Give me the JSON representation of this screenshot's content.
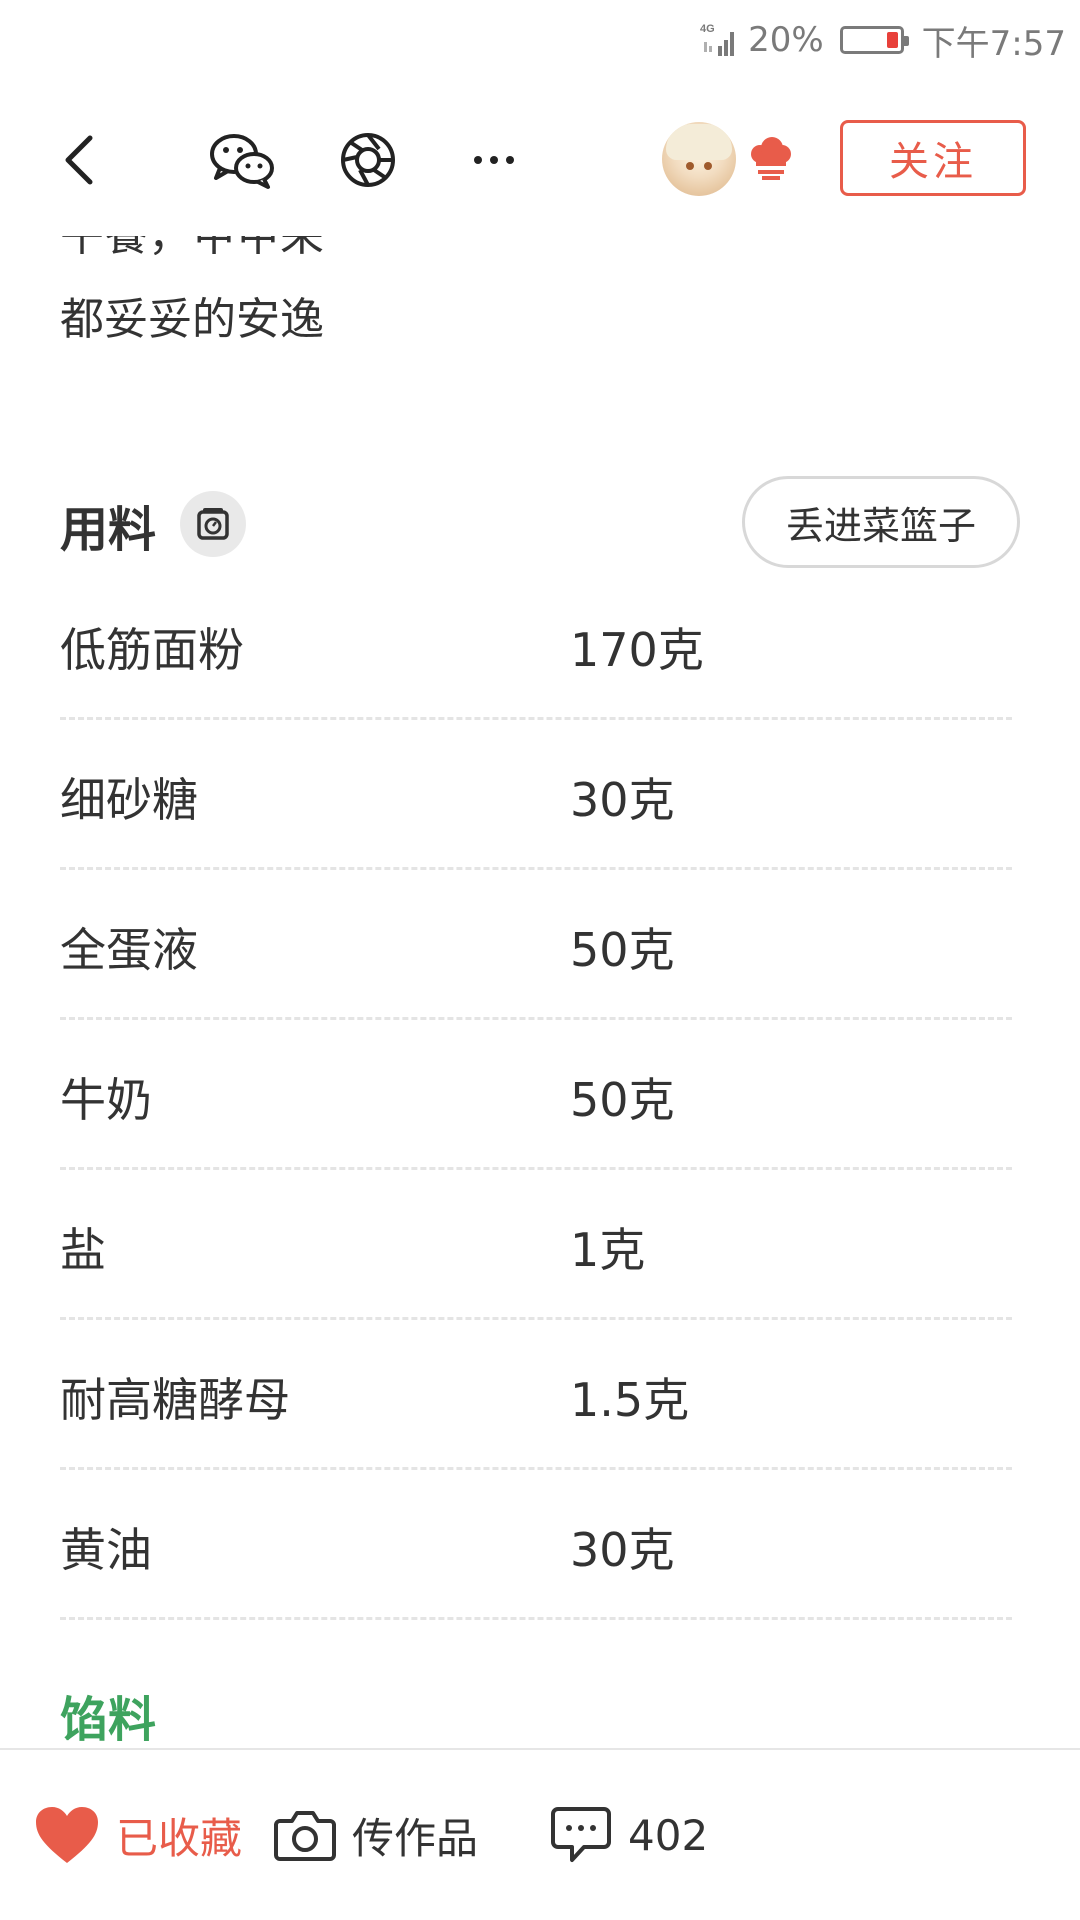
{
  "status_bar": {
    "network": "4G",
    "battery_percent": "20%",
    "time": "下午7:57",
    "battery_color": "#e8403a"
  },
  "nav": {
    "follow_label": "关注",
    "accent_color": "#e85c4a",
    "icons": [
      "back-icon",
      "wechat-icon",
      "moments-icon",
      "more-icon",
      "chef-hat-icon"
    ]
  },
  "description": {
    "line1_clipped": "午餐，甲甲采",
    "line2": "都妥妥的安逸"
  },
  "ingredients": {
    "title": "用料",
    "basket_button": "丢进菜篮子",
    "items": [
      {
        "name": "低筋面粉",
        "qty": "170克"
      },
      {
        "name": "细砂糖",
        "qty": "30克"
      },
      {
        "name": "全蛋液",
        "qty": "50克"
      },
      {
        "name": "牛奶",
        "qty": "50克"
      },
      {
        "name": "盐",
        "qty": "1克"
      },
      {
        "name": "耐高糖酵母",
        "qty": "1.5克"
      },
      {
        "name": "黄油",
        "qty": "30克"
      }
    ]
  },
  "filling": {
    "title": "馅料",
    "color": "#3ea35e"
  },
  "bottom_bar": {
    "collect_label": "已收藏",
    "upload_label": "传作品",
    "comment_count": "402"
  }
}
